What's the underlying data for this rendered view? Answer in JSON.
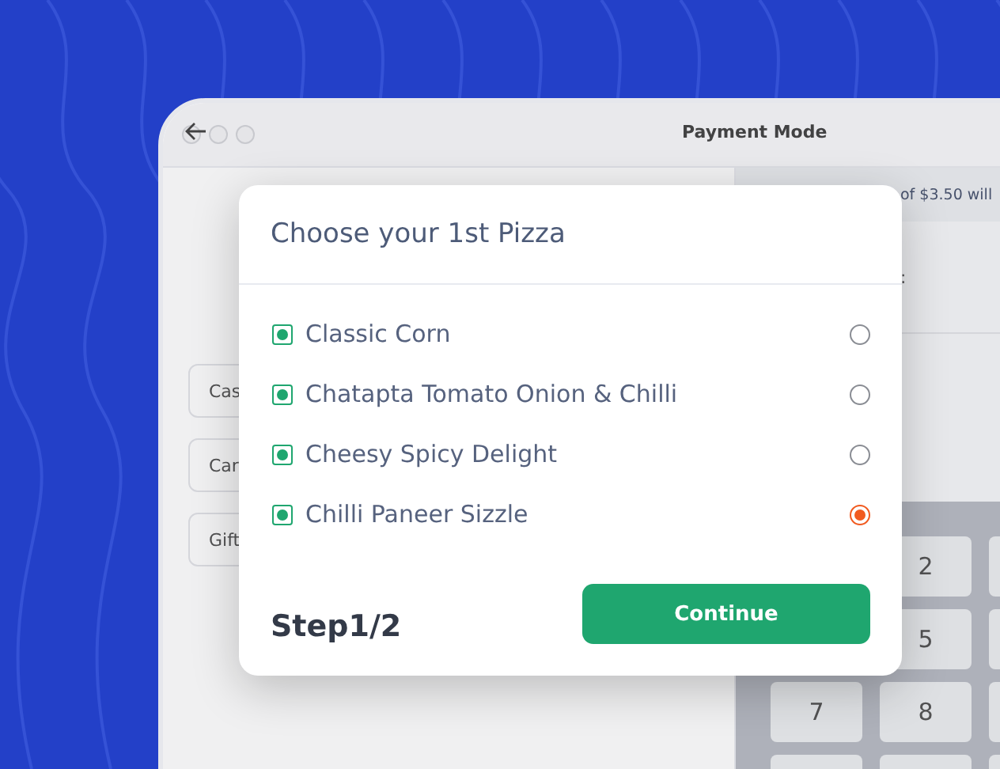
{
  "window": {
    "title": "Payment Mode"
  },
  "payment_methods": [
    {
      "label": "Cas"
    },
    {
      "label": "Car"
    },
    {
      "label": "Gift"
    }
  ],
  "summary": {
    "text": "of $3.50 will",
    "fragment": ":"
  },
  "keypad": {
    "keys": [
      "2",
      "5",
      "7",
      "8"
    ]
  },
  "dialog": {
    "title": "Choose your 1st Pizza",
    "options": [
      {
        "label": "Classic Corn",
        "veg": true,
        "selected": false
      },
      {
        "label": "Chatapta Tomato Onion & Chilli",
        "veg": true,
        "selected": false
      },
      {
        "label": "Cheesy Spicy Delight",
        "veg": true,
        "selected": false
      },
      {
        "label": "Chilli Paneer Sizzle",
        "veg": true,
        "selected": true
      }
    ],
    "step": "Step1/2",
    "button": "Continue"
  }
}
